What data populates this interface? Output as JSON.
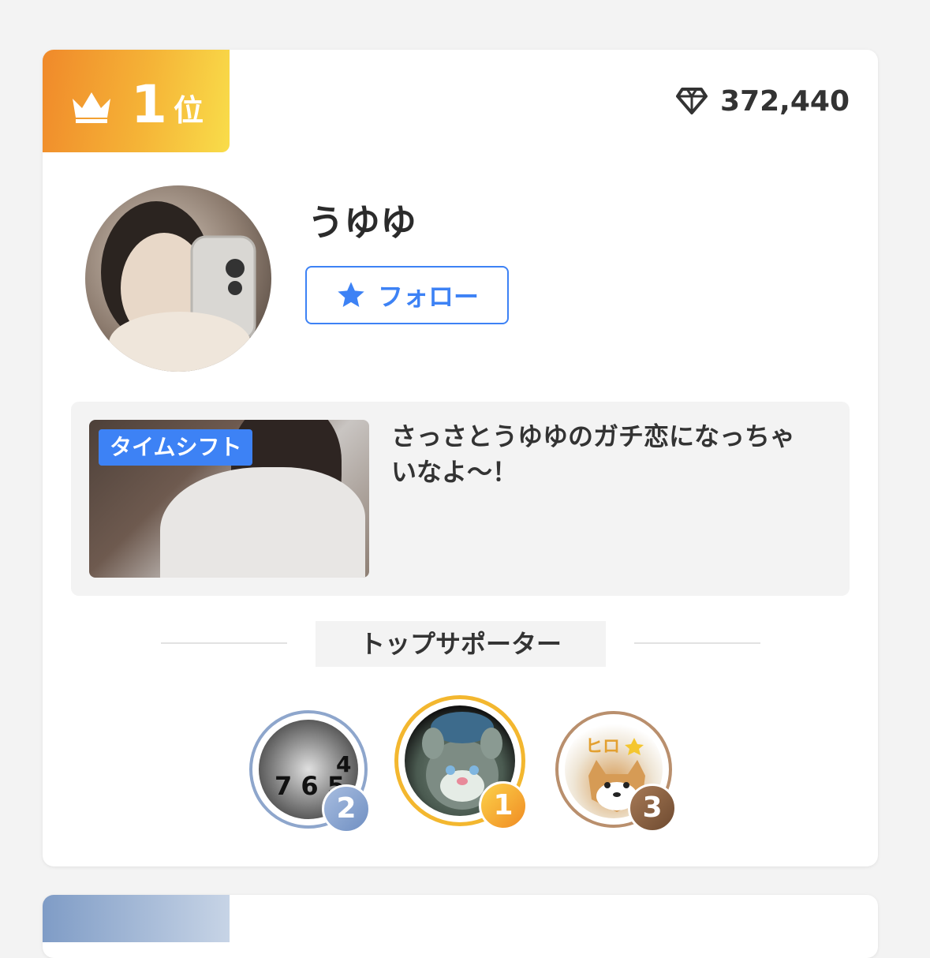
{
  "rank": {
    "number": "1",
    "suffix": "位",
    "crown_icon": "crown-icon",
    "gradient_colors": [
      "#f0892a",
      "#f9dd4a"
    ]
  },
  "score": {
    "icon": "diamond-icon",
    "value": "372,440"
  },
  "profile": {
    "name": "うゆゆ",
    "follow_label": "フォロー",
    "follow_icon": "star-icon",
    "accent_color": "#3d82f5"
  },
  "stream": {
    "tag": "タイムシフト",
    "title": "さっさとうゆゆのガチ恋になっちゃいなよ〜！"
  },
  "supporters": {
    "heading": "トップサポーター",
    "items": [
      {
        "rank": "2",
        "ring_color": "#8ea6cc"
      },
      {
        "rank": "1",
        "ring_color": "#f3b72f"
      },
      {
        "rank": "3",
        "ring_color": "#b98f6d"
      }
    ]
  }
}
